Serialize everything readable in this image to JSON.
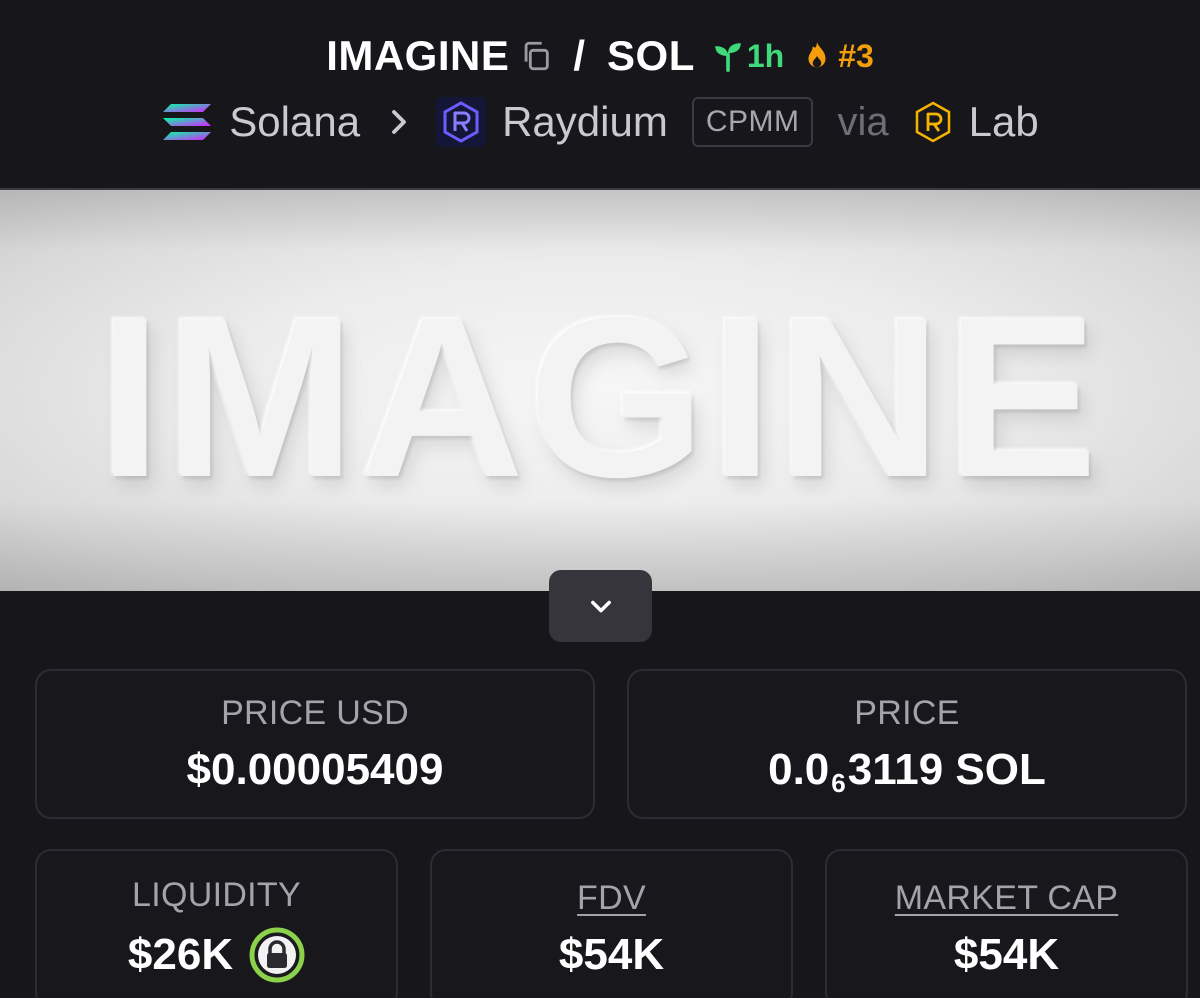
{
  "header": {
    "token": "IMAGINE",
    "separator": "/",
    "quote": "SOL",
    "age": "1h",
    "rank": "#3",
    "icons": [
      "copy-icon",
      "seedling-icon",
      "fire-icon"
    ]
  },
  "breadcrumb": {
    "chain": "Solana",
    "dex": "Raydium",
    "pool_type": "CPMM",
    "via": "via",
    "launchpad": "Lab",
    "icons": [
      "solana-icon",
      "chevron-right-icon",
      "raydium-icon",
      "lab-icon"
    ]
  },
  "banner": {
    "icon": "chevron-down-icon"
  },
  "stats": {
    "price_usd": {
      "label": "PRICE USD",
      "value": "$0.00005409"
    },
    "price_native": {
      "label": "PRICE",
      "prefix": "0.0",
      "subscript": "6",
      "suffix": "3119 SOL"
    },
    "liquidity": {
      "label": "LIQUIDITY",
      "value": "$26K",
      "icon": "lock-icon"
    },
    "fdv": {
      "label": "FDV",
      "value": "$54K"
    },
    "market_cap": {
      "label": "MARKET CAP",
      "value": "$54K"
    }
  },
  "colors": {
    "background": "#16161b",
    "age_green": "#3fd97a",
    "rank_orange": "#f59e0b",
    "lock_green": "#8bd14a",
    "raydium_purple": "#6d5dfc"
  }
}
